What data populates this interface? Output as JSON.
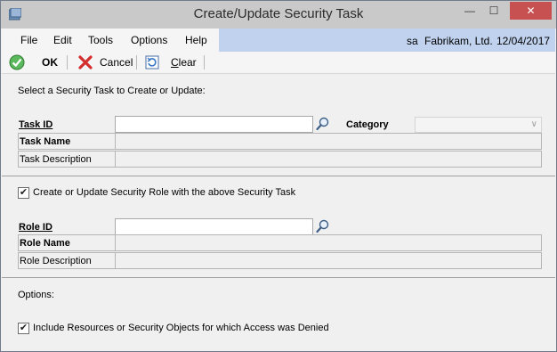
{
  "window": {
    "title": "Create/Update Security Task",
    "minimize_glyph": "—",
    "maximize_glyph": "☐",
    "close_glyph": "✕"
  },
  "menu": {
    "items": [
      "File",
      "Edit",
      "Tools",
      "Options",
      "Help"
    ]
  },
  "status": {
    "user": "sa",
    "company": "Fabrikam, Ltd.",
    "date": "12/04/2017"
  },
  "toolbar": {
    "ok_label": "OK",
    "cancel_label": "Cancel",
    "clear_label": "Clear"
  },
  "task_section": {
    "heading": "Select a Security Task to Create or Update:",
    "task_id_label": "Task ID",
    "task_id_value": "",
    "category_label": "Category",
    "category_value": "",
    "task_name_label": "Task Name",
    "task_name_value": "",
    "task_description_label": "Task Description",
    "task_description_value": ""
  },
  "role_section": {
    "checkbox_label": "Create or Update Security Role with the above Security Task",
    "checkbox_checked": true,
    "role_id_label": "Role ID",
    "role_id_value": "",
    "role_name_label": "Role Name",
    "role_name_value": "",
    "role_description_label": "Role Description",
    "role_description_value": ""
  },
  "options_section": {
    "heading": "Options:",
    "include_label": "Include Resources or Security Objects for which Access was Denied",
    "include_checked": true
  },
  "colors": {
    "titlebar": "#c9c9c9",
    "close_button": "#c75050",
    "status_band": "#c0d2ed",
    "window_bg": "#f0f0f0"
  },
  "icons": {
    "ok": "green-check-icon",
    "cancel": "red-x-icon",
    "clear": "clear-form-icon",
    "lookup": "magnifier-icon"
  }
}
